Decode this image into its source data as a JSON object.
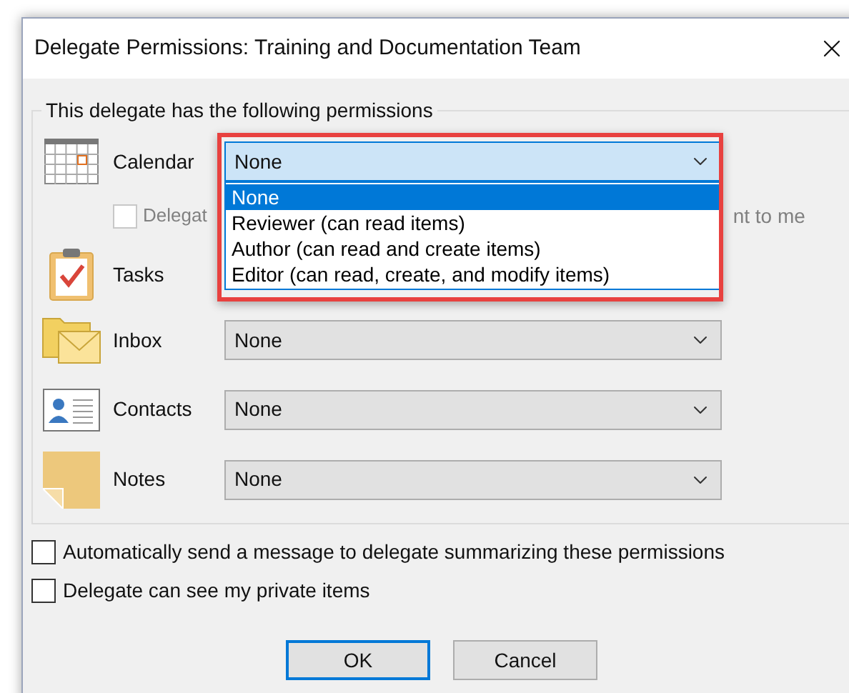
{
  "window": {
    "title": "Delegate Permissions: Training and Documentation Team"
  },
  "group": {
    "legend": "This delegate has the following permissions",
    "rows": [
      {
        "kind": "calendar",
        "label": "Calendar",
        "value": "None",
        "focused": true
      },
      {
        "kind": "tasks",
        "label": "Tasks"
      },
      {
        "kind": "inbox",
        "label": "Inbox",
        "value": "None",
        "focused": false
      },
      {
        "kind": "contacts",
        "label": "Contacts",
        "value": "None",
        "focused": false
      },
      {
        "kind": "notes",
        "label": "Notes",
        "value": "None",
        "focused": false
      }
    ],
    "meeting_checkbox": {
      "checked": false,
      "disabled": true,
      "text_start": "Delegat",
      "text_end": "nt to me"
    }
  },
  "dropdown_list": {
    "items": [
      {
        "label": "None",
        "selected": true
      },
      {
        "label": "Reviewer (can read items)",
        "selected": false
      },
      {
        "label": "Author (can read and create items)",
        "selected": false
      },
      {
        "label": "Editor (can read, create, and modify items)",
        "selected": false
      }
    ]
  },
  "options": [
    {
      "label": "Automatically send a message to delegate summarizing these permissions",
      "checked": false
    },
    {
      "label": "Delegate can see my private items",
      "checked": false
    }
  ],
  "buttons": [
    {
      "label": "OK",
      "default": true
    },
    {
      "label": "Cancel",
      "default": false
    }
  ]
}
